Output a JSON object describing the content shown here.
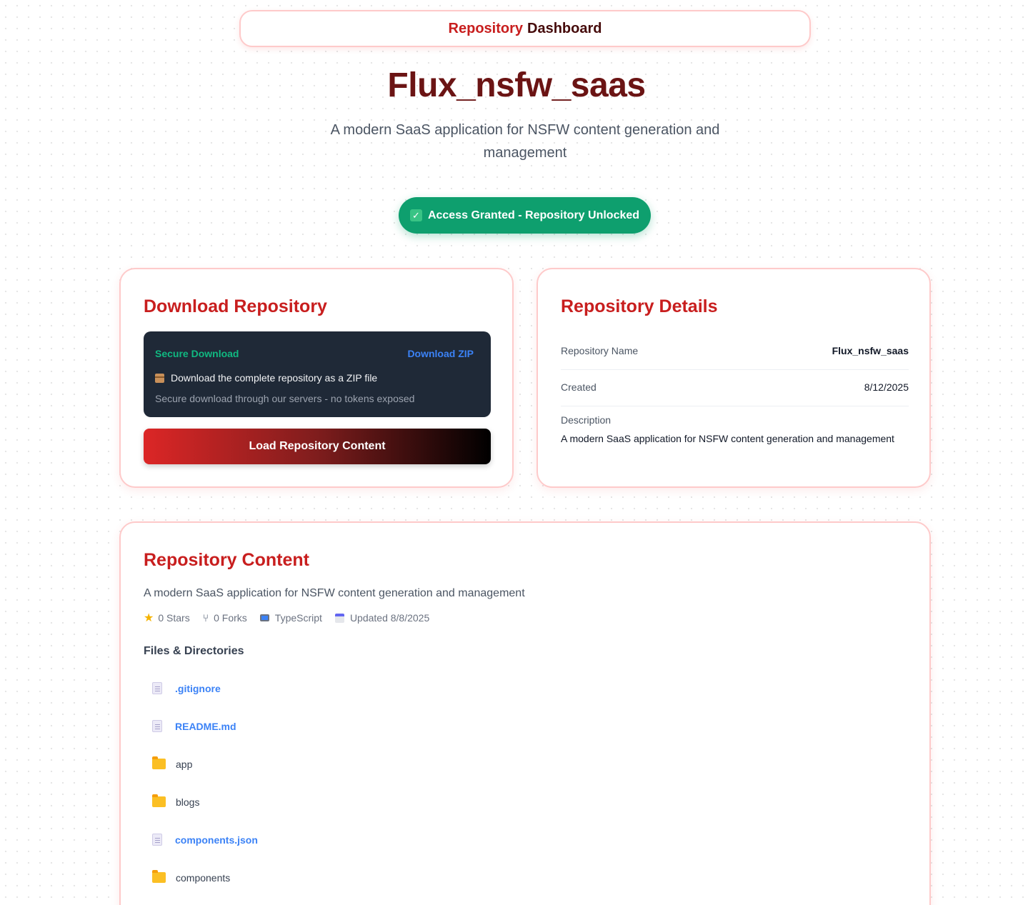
{
  "header": {
    "word1": "Repository",
    "word2": "Dashboard"
  },
  "hero": {
    "title": "Flux_nsfw_saas",
    "subtitle": "A modern SaaS application for NSFW content generation and management"
  },
  "access": {
    "label": "Access Granted - Repository Unlocked",
    "check": "✓"
  },
  "download": {
    "title": "Download Repository",
    "secure_label": "Secure Download",
    "zip_link": "Download ZIP",
    "line1": "Download the complete repository as a ZIP file",
    "line2": "Secure download through our servers - no tokens exposed",
    "load_button": "Load Repository Content"
  },
  "details": {
    "title": "Repository Details",
    "name_label": "Repository Name",
    "name_value": "Flux_nsfw_saas",
    "created_label": "Created",
    "created_value": "8/12/2025",
    "description_label": "Description",
    "description_value": "A modern SaaS application for NSFW content generation and management"
  },
  "content": {
    "title": "Repository Content",
    "description": "A modern SaaS application for NSFW content generation and management",
    "stars": "0 Stars",
    "forks": "0 Forks",
    "language": "TypeScript",
    "updated": "Updated 8/8/2025",
    "files_heading": "Files & Directories",
    "files": [
      {
        "name": ".gitignore",
        "type": "file"
      },
      {
        "name": "README.md",
        "type": "file"
      },
      {
        "name": "app",
        "type": "dir"
      },
      {
        "name": "blogs",
        "type": "dir"
      },
      {
        "name": "components.json",
        "type": "file"
      },
      {
        "name": "components",
        "type": "dir"
      }
    ]
  },
  "icons": [
    "check-icon",
    "package-icon",
    "star-icon",
    "fork-icon",
    "laptop-icon",
    "calendar-icon",
    "file-icon",
    "folder-icon"
  ]
}
